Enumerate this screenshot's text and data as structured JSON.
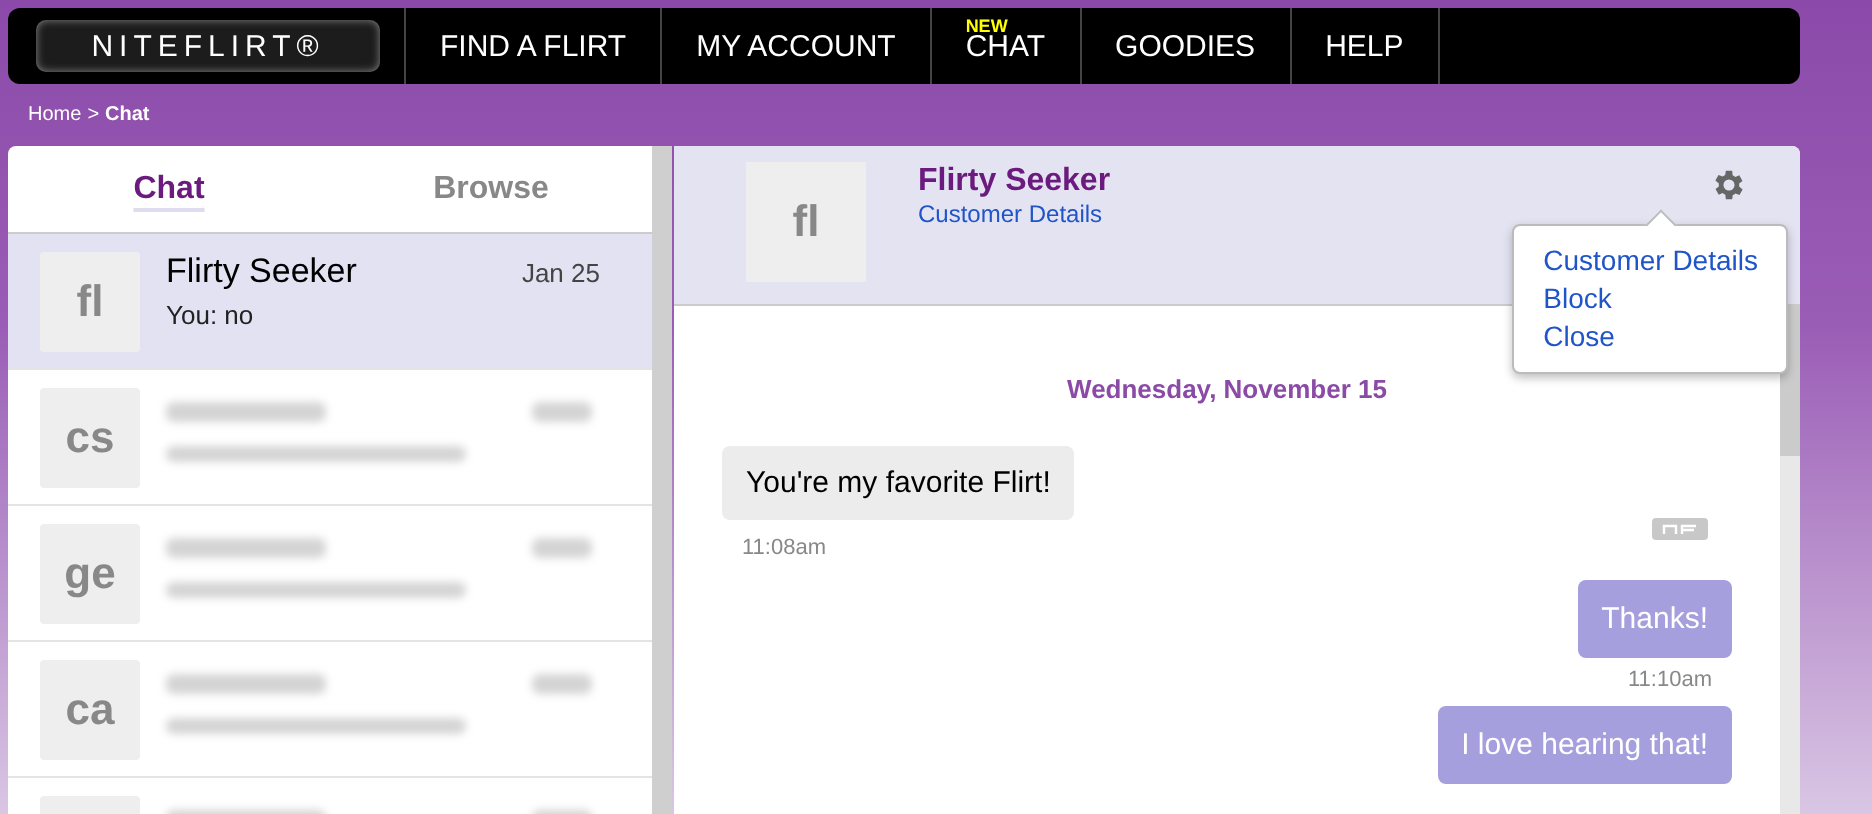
{
  "nav": {
    "logo": "NITEFLIRT®",
    "items": [
      {
        "label": "FIND A FLIRT"
      },
      {
        "label": "MY ACCOUNT"
      },
      {
        "label": "CHAT",
        "badge": "NEW"
      },
      {
        "label": "GOODIES"
      },
      {
        "label": "HELP"
      }
    ]
  },
  "breadcrumb": {
    "items": [
      "Home",
      "Chat"
    ],
    "separator": ">"
  },
  "tabs": [
    {
      "label": "Chat",
      "selected": true
    },
    {
      "label": "Browse",
      "selected": false
    }
  ],
  "conversations": [
    {
      "initials": "fl",
      "name": "Flirty Seeker",
      "date": "Jan 25",
      "preview": "You: no",
      "selected": true,
      "blurred": false
    },
    {
      "initials": "cs",
      "selected": false,
      "blurred": true
    },
    {
      "initials": "ge",
      "selected": false,
      "blurred": true
    },
    {
      "initials": "ca",
      "selected": false,
      "blurred": true
    },
    {
      "selected": false,
      "blurred": true
    }
  ],
  "chat": {
    "header": {
      "initials": "fl",
      "name": "Flirty Seeker",
      "link": "Customer Details"
    },
    "menu": {
      "open": true,
      "items": [
        "Customer Details",
        "Block",
        "Close"
      ]
    },
    "date": "Wednesday, November 15",
    "messages": [
      {
        "outgoing": false,
        "text": "You're my favorite Flirt!",
        "time": "11:08am"
      },
      {
        "outgoing": true,
        "text": "Thanks!",
        "time": "11:10am"
      },
      {
        "outgoing": true,
        "text": "I love hearing that!"
      }
    ]
  }
}
